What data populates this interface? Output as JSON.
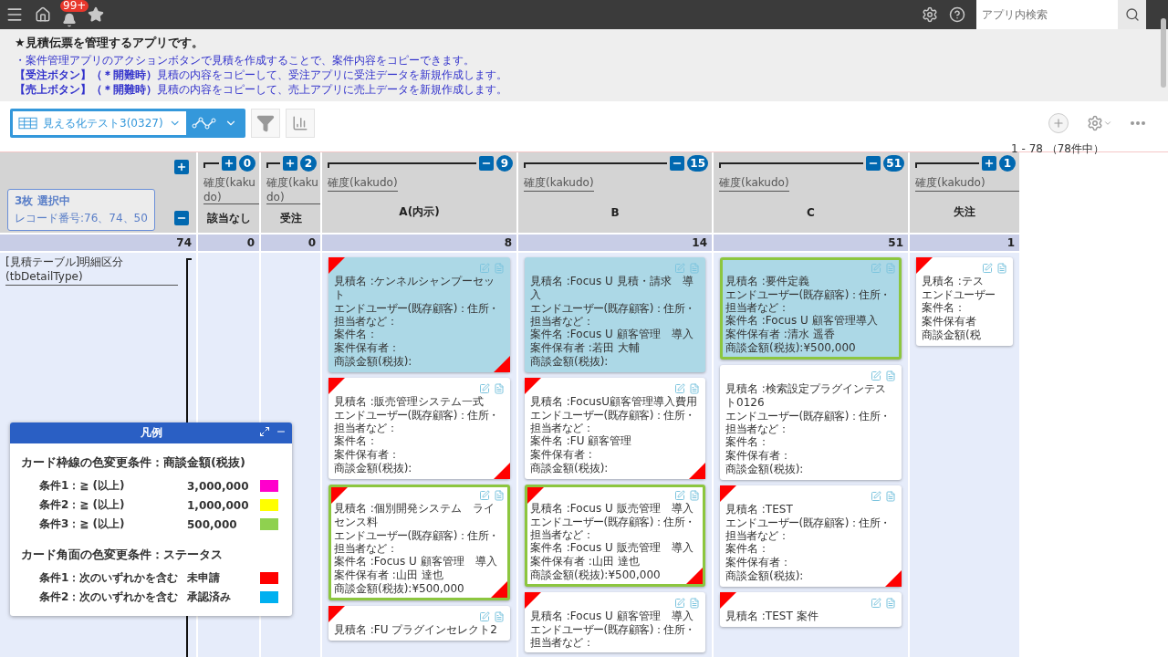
{
  "top_bar": {
    "notification_badge": "99+",
    "search": {
      "placeholder": "アプリ内検索"
    }
  },
  "description": {
    "title": "★見積伝票を管理するアプリです。",
    "lines": [
      "・案件管理アプリのアクションボタンで見積を作成することで、案件内容をコピーできます。",
      "**【受注ボタン】（＊開難時）**見積の内容をコピーして、受注アプリに受注データを新規作成します。",
      "**【売上ボタン】（＊開難時）**見積の内容をコピーして、売上アプリに売上データを新規作成します。"
    ]
  },
  "toolbar": {
    "view": "見える化テスト3(0327)",
    "record_range": "1 - 78 （78件中）"
  },
  "board": {
    "selection": {
      "title": "3枚 選択中",
      "records": "レコード番号:76、74、50"
    },
    "row_total": "74",
    "row_label": "[見積テーブル]明細区分(tbDetailType)",
    "columns": [
      {
        "field": "確度(kakudo)",
        "value": "該当なし",
        "expanded": false,
        "badge": "0",
        "total": "0"
      },
      {
        "field": "確度(kakudo)",
        "value": "受注",
        "expanded": false,
        "badge": "2",
        "total": "0"
      },
      {
        "field": "確度(kakudo)",
        "value": "A(内示)",
        "expanded": true,
        "badge": "9",
        "total": "8",
        "cards": [
          {
            "selected": true,
            "framed": false,
            "top_flag": true,
            "bottom_flag": true,
            "name": "見積名 :ケンネルシャンプーセット",
            "end_user": "エンドユーザー(既存顧客)：住所・担当者など：",
            "project": "案件名：",
            "owner": "案件保有者：",
            "amount": "商談金額(税抜):"
          },
          {
            "selected": false,
            "framed": false,
            "top_flag": true,
            "bottom_flag": true,
            "name": "見積名 :販売管理システム一式",
            "end_user": "エンドユーザー(既存顧客)：住所・担当者など：",
            "project": "案件名：",
            "owner": "案件保有者：",
            "amount": "商談金額(税抜):"
          },
          {
            "selected": false,
            "framed": true,
            "top_flag": true,
            "bottom_flag": true,
            "name": "見積名 :個別開発システム　ライセンス料",
            "end_user": "エンドユーザー(既存顧客)：住所・担当者など：",
            "project": "案件名 :Focus U 顧客管理　導入",
            "owner": "案件保有者 :山田 達也",
            "amount": "商談金額(税抜):¥500,000"
          },
          {
            "selected": false,
            "framed": false,
            "top_flag": true,
            "bottom_flag": false,
            "name": "見積名 :FU プラグインセレクト2"
          }
        ]
      },
      {
        "field": "確度(kakudo)",
        "value": "B",
        "expanded": true,
        "badge": "15",
        "total": "14",
        "cards": [
          {
            "selected": true,
            "framed": false,
            "top_flag": false,
            "bottom_flag": false,
            "name": "見積名 :Focus U 見積・請求　導入",
            "end_user": "エンドユーザー(既存顧客)：住所・担当者など：",
            "project": "案件名 :Focus U 顧客管理　導入",
            "owner": "案件保有者 :若田 大輔",
            "amount": "商談金額(税抜):"
          },
          {
            "selected": false,
            "framed": false,
            "top_flag": true,
            "bottom_flag": true,
            "name": "見積名 :FocusU顧客管理導入費用",
            "end_user": "エンドユーザー(既存顧客)：住所・担当者など：",
            "project": "案件名 :FU 顧客管理",
            "owner": "案件保有者 :",
            "amount": "商談金額(税抜):"
          },
          {
            "selected": false,
            "framed": true,
            "top_flag": true,
            "bottom_flag": true,
            "name": "見積名 :Focus U 販売管理　導入",
            "end_user": "エンドユーザー(既存顧客)：住所・担当者など：",
            "project": "案件名 :Focus U 販売管理　導入",
            "owner": "案件保有者 :山田 達也",
            "amount": "商談金額(税抜):¥500,000"
          },
          {
            "selected": false,
            "framed": false,
            "top_flag": true,
            "bottom_flag": false,
            "name": "見積名 :Focus U 顧客管理　導入",
            "end_user": "エンドユーザー(既存顧客)：住所・担当者など："
          }
        ]
      },
      {
        "field": "確度(kakudo)",
        "value": "C",
        "expanded": true,
        "badge": "51",
        "total": "51",
        "cards": [
          {
            "selected": true,
            "framed": true,
            "top_flag": false,
            "bottom_flag": false,
            "name": "見積名 :要件定義",
            "end_user": "エンドユーザー(既存顧客)：住所・担当者など：",
            "project": "案件名 :Focus U 顧客管理導入",
            "owner": "案件保有者 :清水 遥香",
            "amount": "商談金額(税抜):¥500,000"
          },
          {
            "selected": false,
            "framed": false,
            "top_flag": false,
            "bottom_flag": false,
            "name": "見積名 :検索設定プラグインテスト0126",
            "end_user": "エンドユーザー(既存顧客)：住所・担当者など：",
            "project": "案件名：",
            "owner": "案件保有者：",
            "amount": "商談金額(税抜):"
          },
          {
            "selected": false,
            "framed": false,
            "top_flag": true,
            "bottom_flag": true,
            "name": "見積名 :TEST",
            "end_user": "エンドユーザー(既存顧客)：住所・担当者など：",
            "project": "案件名：",
            "owner": "案件保有者：",
            "amount": "商談金額(税抜):"
          },
          {
            "selected": false,
            "framed": false,
            "top_flag": true,
            "bottom_flag": false,
            "name": "見積名 :TEST 案件"
          }
        ]
      },
      {
        "field": "確度(kakudo)",
        "value": "失注",
        "expanded": false,
        "badge": "1",
        "total": "1",
        "cards": [
          {
            "selected": false,
            "framed": false,
            "top_flag": true,
            "bottom_flag": false,
            "name": "見積名 :テス",
            "end_user": "エンドユーザー",
            "project": "案件名：",
            "owner": "案件保有者",
            "amount": "商談金額(税"
          }
        ]
      }
    ]
  },
  "legend": {
    "title": "凡例",
    "sections": [
      {
        "heading": "カード枠線の色変更条件：商談金額(税抜)",
        "rows": [
          {
            "condition": "条件1：≧ (以上)",
            "value": "3,000,000",
            "color": "#ff00cc"
          },
          {
            "condition": "条件2：≧ (以上)",
            "value": "1,000,000",
            "color": "#ffff00"
          },
          {
            "condition": "条件3：≧ (以上)",
            "value": "500,000",
            "color": "#8fd14f"
          }
        ]
      },
      {
        "heading": "カード角面の色変更条件：ステータス",
        "rows": [
          {
            "condition": "条件1：次のいずれかを含む",
            "value": "未申請",
            "color": "#ff0000"
          },
          {
            "condition": "条件2：次のいずれかを含む",
            "value": "承認済み",
            "color": "#00b0f0"
          }
        ]
      }
    ]
  }
}
